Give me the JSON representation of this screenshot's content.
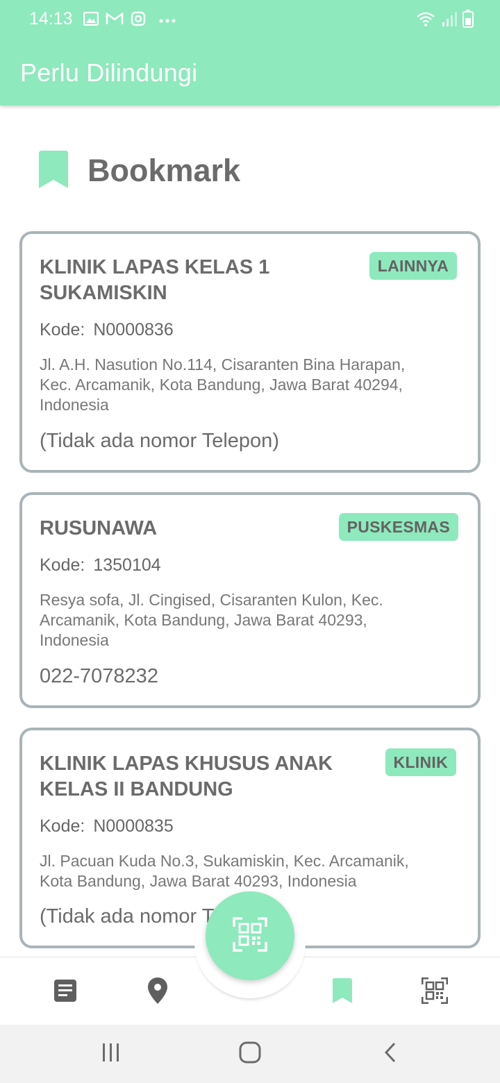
{
  "status_bar": {
    "time": "14:13",
    "left_icons": [
      "image-icon",
      "gmail-icon",
      "instagram-icon",
      "more-dots-icon"
    ],
    "right_icons": [
      "wifi-icon",
      "signal-icon",
      "battery-icon"
    ]
  },
  "app": {
    "title": "Perlu Dilindungi"
  },
  "section": {
    "icon": "bookmark-icon",
    "title": "Bookmark"
  },
  "cards": [
    {
      "name_line1": "KLINIK LAPAS KELAS 1",
      "name_line2": "SUKAMISKIN",
      "badge": "LAINNYA",
      "kode_label": "Kode:",
      "kode_value": "N0000836",
      "address_line1": "Jl. A.H. Nasution No.114, Cisaranten Bina Harapan,",
      "address_line2": "Kec. Arcamanik, Kota Bandung, Jawa Barat 40294,",
      "address_line3": "Indonesia",
      "phone": "(Tidak ada nomor Telepon)"
    },
    {
      "name_line1": "RUSUNAWA",
      "name_line2": "",
      "badge": "PUSKESMAS",
      "kode_label": "Kode:",
      "kode_value": "1350104",
      "address_line1": "Resya sofa, Jl. Cingised, Cisaranten Kulon, Kec.",
      "address_line2": "Arcamanik, Kota Bandung, Jawa Barat 40293,",
      "address_line3": "Indonesia",
      "phone": "022-7078232"
    },
    {
      "name_line1": "KLINIK LAPAS KHUSUS ANAK",
      "name_line2": "KELAS II BANDUNG",
      "badge": "KLINIK",
      "kode_label": "Kode:",
      "kode_value": "N0000835",
      "address_line1": "Jl. Pacuan Kuda No.3, Sukamiskin, Kec. Arcamanik,",
      "address_line2": "Kota Bandung, Jawa Barat 40293, Indonesia",
      "address_line3": "",
      "phone": "(Tidak ada nomor Telepon)"
    }
  ],
  "bottom_nav": {
    "items": [
      "news-icon",
      "location-pin-icon",
      "bookmark-icon",
      "qr-code-icon"
    ],
    "active": "bookmark-icon",
    "fab_icon": "qr-scan-icon"
  },
  "system_nav": [
    "recents-icon",
    "home-icon",
    "back-icon"
  ],
  "colors": {
    "accent": "#8ee9bd",
    "card_border": "#aab4b8",
    "text": "#6b6b6b"
  }
}
